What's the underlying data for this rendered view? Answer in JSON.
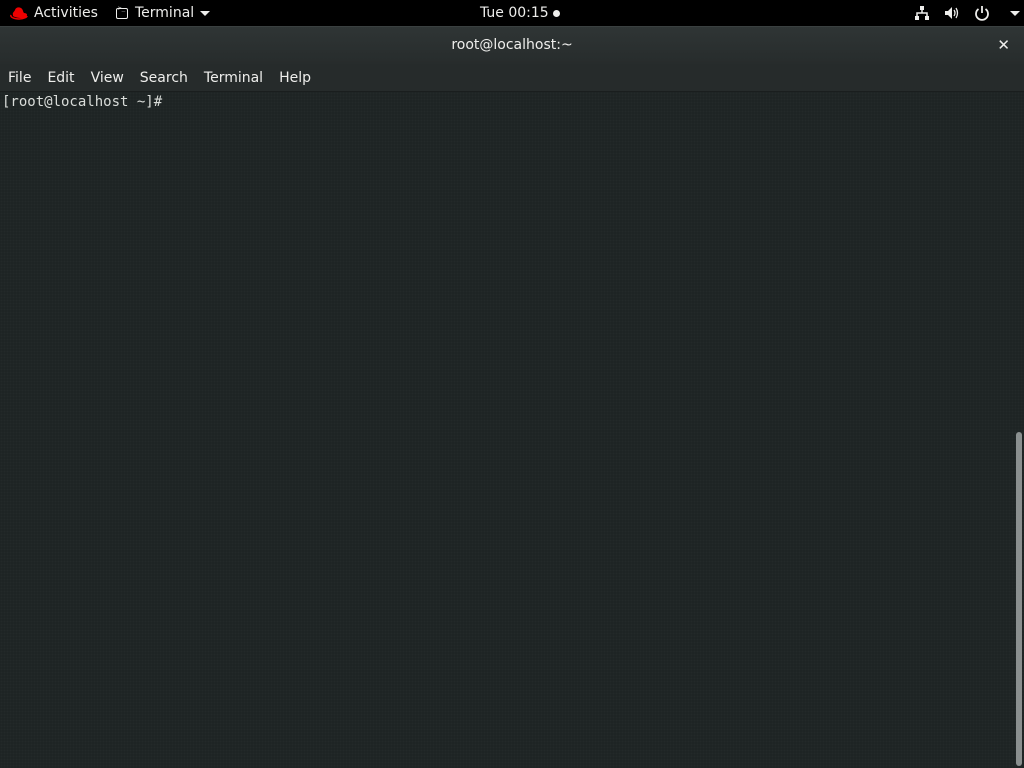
{
  "topbar": {
    "activities_label": "Activities",
    "app_menu_label": "Terminal",
    "clock": "Tue 00:15"
  },
  "window": {
    "title": "root@localhost:~",
    "close_glyph": "✕"
  },
  "menubar": {
    "items": [
      "File",
      "Edit",
      "View",
      "Search",
      "Terminal",
      "Help"
    ]
  },
  "terminal": {
    "prompt": "[root@localhost ~]#"
  },
  "colors": {
    "topbar_bg": "#000000",
    "terminal_bg": "#1e2424",
    "redhat_red": "#ee0000"
  }
}
